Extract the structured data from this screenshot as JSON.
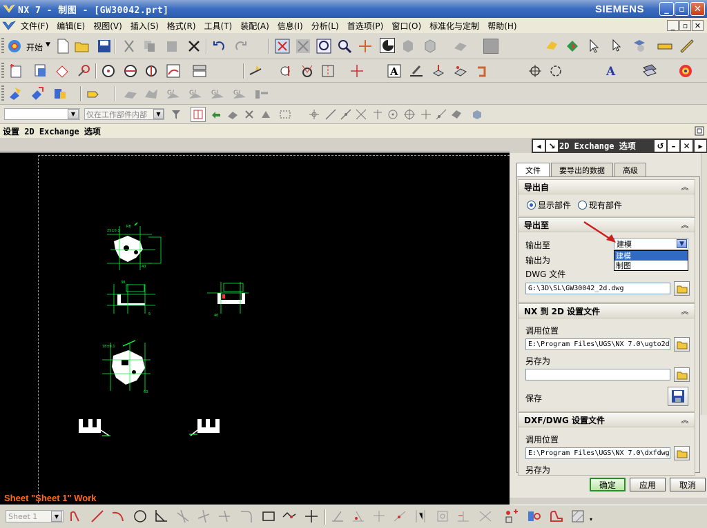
{
  "window": {
    "title": "NX 7 - 制图 - [GW30042.prt]",
    "brand": "SIEMENS"
  },
  "menu": [
    "文件(F)",
    "编辑(E)",
    "视图(V)",
    "插入(S)",
    "格式(R)",
    "工具(T)",
    "装配(A)",
    "信息(I)",
    "分析(L)",
    "首选项(P)",
    "窗口(O)",
    "标准化与定制",
    "帮助(H)"
  ],
  "toolbar": {
    "start_label": "开始",
    "filter_placeholder": "",
    "scope_label": "仅在工作部件内部"
  },
  "status_line": "设置 2D Exchange 选项",
  "panel": {
    "title": "2D Exchange 选项",
    "tabs": [
      "文件",
      "要导出的数据",
      "高级"
    ],
    "export_from": {
      "header": "导出自",
      "options": [
        "显示部件",
        "现有部件"
      ],
      "selected": "显示部件"
    },
    "export_to": {
      "header": "导出至",
      "output_to_label": "输出至",
      "output_to_value": "建模",
      "dropdown_options": [
        "建模",
        "制图"
      ],
      "output_as_label": "输出为",
      "dwg_label": "DWG 文件",
      "dwg_path": "G:\\3D\\SL\\GW30042_2d.dwg"
    },
    "nx_to_2d": {
      "header": "NX 到 2D 设置文件",
      "call_location_label": "调用位置",
      "call_location_value": "E:\\Program Files\\UGS\\NX 7.0\\ugto2d",
      "save_as_label": "另存为",
      "save_as_value": "",
      "save_label": "保存"
    },
    "dxf_dwg": {
      "header": "DXF/DWG 设置文件",
      "call_location_label": "调用位置",
      "call_location_value": "E:\\Program Files\\UGS\\NX 7.0\\dxfdwg",
      "save_as_label": "另存为"
    },
    "buttons": {
      "ok": "确定",
      "apply": "应用",
      "cancel": "取消"
    }
  },
  "canvas": {
    "sheet_label": "Sheet \"Sheet 1\" Work"
  },
  "bottom_bar": {
    "sheet_select": "Sheet 1"
  },
  "colors": {
    "title_blue": "#2a5cb0",
    "canvas_bg": "#000000",
    "drawing_green": "#00ff40",
    "drawing_white": "#ffffff",
    "sheet_label": "#ff6a1a",
    "arrow_red": "#cc1f1f"
  }
}
